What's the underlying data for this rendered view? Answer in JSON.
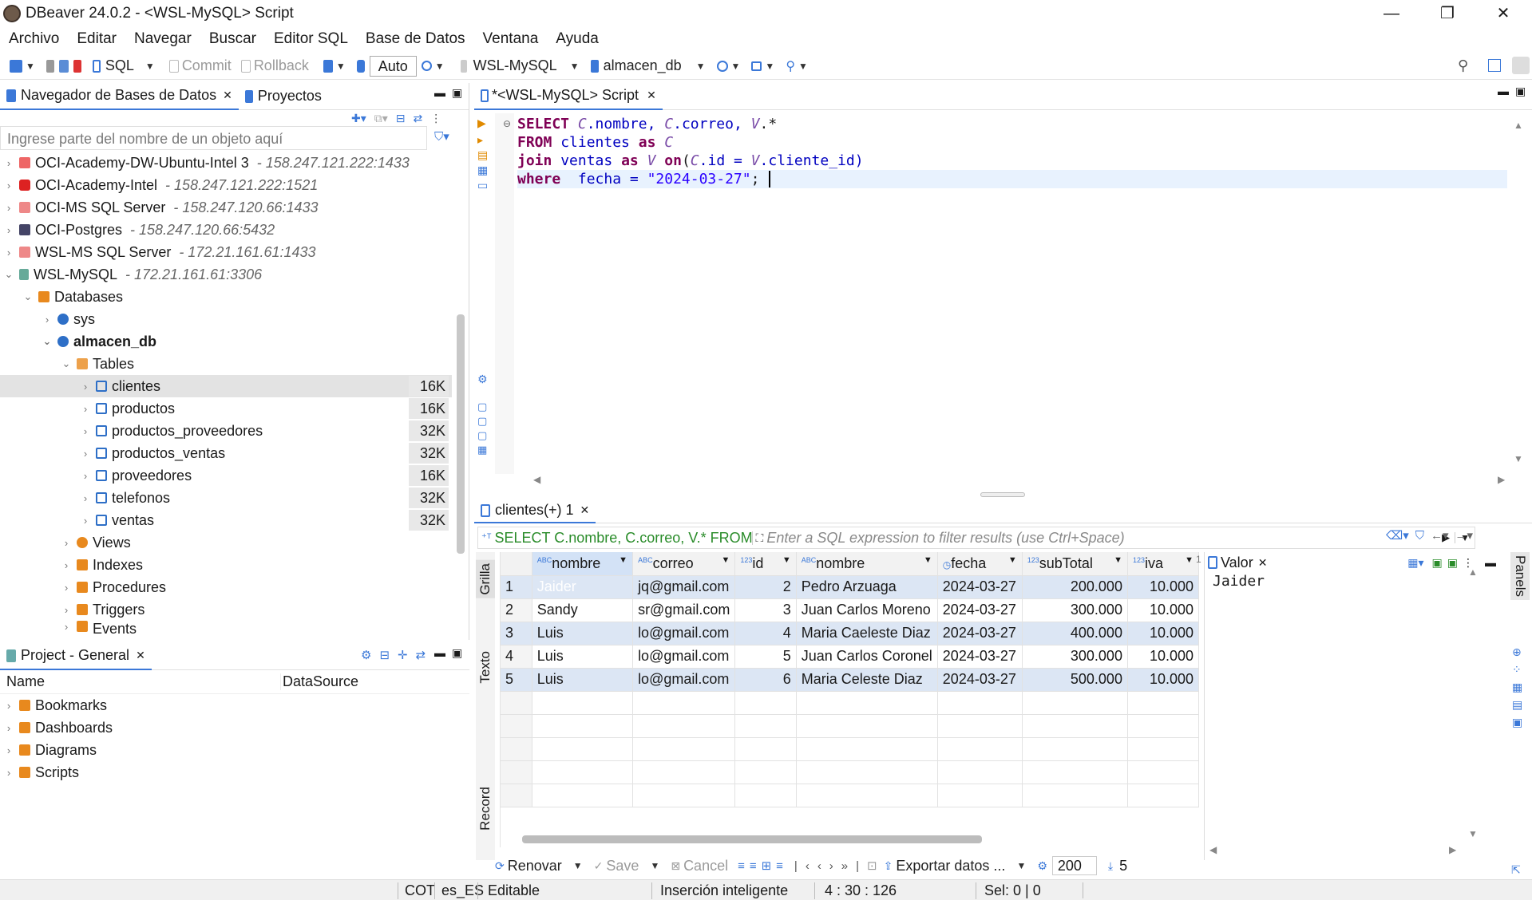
{
  "window": {
    "title": "DBeaver 24.0.2 - <WSL-MySQL> Script",
    "min": "—",
    "max": "❐",
    "close": "✕"
  },
  "menu": [
    "Archivo",
    "Editar",
    "Navegar",
    "Buscar",
    "Editor SQL",
    "Base de Datos",
    "Ventana",
    "Ayuda"
  ],
  "toolbar": {
    "sql": "SQL",
    "commit": "Commit",
    "rollback": "Rollback",
    "auto": "Auto",
    "connection": "WSL-MySQL",
    "database": "almacen_db"
  },
  "nav": {
    "tab1": "Navegador de Bases de Datos",
    "tab2": "Proyectos",
    "filter_placeholder": "Ingrese parte del nombre de un objeto aquí",
    "items": [
      {
        "name": "OCI-Academy-DW-Ubuntu-Intel 3",
        "meta": "- 158.247.121.222:1433"
      },
      {
        "name": "OCI-Academy-Intel",
        "meta": "- 158.247.121.222:1521"
      },
      {
        "name": "OCI-MS SQL Server",
        "meta": "- 158.247.120.66:1433"
      },
      {
        "name": "OCI-Postgres",
        "meta": "- 158.247.120.66:5432"
      },
      {
        "name": "WSL-MS SQL Server",
        "meta": "- 172.21.161.61:1433"
      },
      {
        "name": "WSL-MySQL",
        "meta": "- 172.21.161.61:3306"
      }
    ],
    "databases": "Databases",
    "sys": "sys",
    "almacen": "almacen_db",
    "tables": "Tables",
    "table_list": [
      {
        "name": "clientes",
        "size": "16K"
      },
      {
        "name": "productos",
        "size": "16K"
      },
      {
        "name": "productos_proveedores",
        "size": "32K"
      },
      {
        "name": "productos_ventas",
        "size": "32K"
      },
      {
        "name": "proveedores",
        "size": "16K"
      },
      {
        "name": "telefonos",
        "size": "32K"
      },
      {
        "name": "ventas",
        "size": "32K"
      }
    ],
    "folders": [
      "Views",
      "Indexes",
      "Procedures",
      "Triggers",
      "Events"
    ]
  },
  "project": {
    "tab": "Project - General",
    "col_name": "Name",
    "col_ds": "DataSource",
    "items": [
      "Bookmarks",
      "Dashboards",
      "Diagrams",
      "Scripts"
    ]
  },
  "editor": {
    "tab": "*<WSL-MySQL> Script",
    "lines": [
      {
        "a": "SELECT",
        "b": " C",
        "c": ".nombre, ",
        "d": "C",
        "e": ".correo, ",
        "f": "V",
        "g": ".*"
      },
      {
        "a": "FROM",
        "b": " clientes ",
        "c": "as",
        "d": " C"
      },
      {
        "a": "join",
        "b": " ventas ",
        "c": "as",
        "d": " V",
        "e": " on",
        "f": "(",
        "g": "C",
        "h": ".id = ",
        "i": "V",
        "j": ".cliente_id)"
      },
      {
        "a": "where",
        "b": "  fecha = ",
        "c": "\"2024-03-27\"",
        "d": ";"
      }
    ]
  },
  "results": {
    "tab": "clientes(+) 1",
    "query": "SELECT C.nombre, C.correo, V.* FROM",
    "filter_placeholder": "Enter a SQL expression to filter results (use Ctrl+Space)",
    "side_grid": "Grilla",
    "side_text": "Texto",
    "side_record": "Record",
    "columns": [
      {
        "label": "nombre",
        "type": "ABC"
      },
      {
        "label": "correo",
        "type": "ABC"
      },
      {
        "label": "id",
        "type": "123"
      },
      {
        "label": "nombre",
        "type": "ABC"
      },
      {
        "label": "fecha",
        "type": ""
      },
      {
        "label": "subTotal",
        "type": "123"
      },
      {
        "label": "iva",
        "type": "123"
      }
    ],
    "rows": [
      [
        "1",
        "Jaider",
        "jq@gmail.com",
        "2",
        "Pedro Arzuaga",
        "2024-03-27",
        "200.000",
        "10.000"
      ],
      [
        "2",
        "Sandy",
        "sr@gmail.com",
        "3",
        "Juan Carlos Moreno",
        "2024-03-27",
        "300.000",
        "10.000"
      ],
      [
        "3",
        "Luis",
        "lo@gmail.com",
        "4",
        "Maria Caeleste Diaz",
        "2024-03-27",
        "400.000",
        "10.000"
      ],
      [
        "4",
        "Luis",
        "lo@gmail.com",
        "5",
        "Juan Carlos Coronel",
        "2024-03-27",
        "300.000",
        "10.000"
      ],
      [
        "5",
        "Luis",
        "lo@gmail.com",
        "6",
        "Maria Celeste Diaz",
        "2024-03-27",
        "500.000",
        "10.000"
      ]
    ],
    "col_overflow": "1",
    "value_panel_title": "Valor",
    "value_text": "Jaider",
    "panels": "Panels",
    "bottom": {
      "refresh": "Renovar",
      "save": "Save",
      "cancel": "Cancel",
      "export": "Exportar datos ...",
      "fetch": "200",
      "count": "5"
    }
  },
  "status": {
    "tz": "COT",
    "locale": "es_ES",
    "mode": "Editable",
    "insert": "Inserción inteligente",
    "pos": "4 : 30 : 126",
    "sel": "Sel: 0 | 0"
  }
}
